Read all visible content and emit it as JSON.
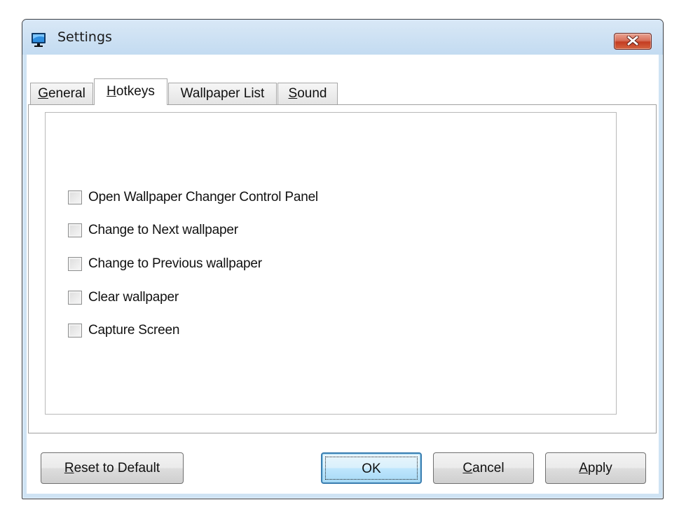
{
  "window": {
    "title": "Settings",
    "icon": "monitor-icon",
    "close_icon": "close-icon"
  },
  "tabs": [
    {
      "label": "General",
      "mnemonic": "G",
      "rest": "eneral",
      "active": false
    },
    {
      "label": "Hotkeys",
      "mnemonic": "H",
      "rest": "otkeys",
      "active": true
    },
    {
      "label": "Wallpaper List",
      "mnemonic": "",
      "rest": "Wallpaper List",
      "active": false
    },
    {
      "label": "Sound",
      "mnemonic": "S",
      "rest": "ound",
      "active": false
    }
  ],
  "hotkeys": {
    "options": [
      {
        "label": "Open Wallpaper Changer Control Panel",
        "checked": false
      },
      {
        "label": "Change to Next wallpaper",
        "checked": false
      },
      {
        "label": "Change to Previous wallpaper",
        "checked": false
      },
      {
        "label": "Clear wallpaper",
        "checked": false
      },
      {
        "label": "Capture Screen",
        "checked": false
      }
    ]
  },
  "buttons": {
    "reset": {
      "label": "Reset to Default",
      "mnemonic": "R",
      "rest": "eset to Default"
    },
    "ok": {
      "label": "OK"
    },
    "cancel": {
      "label": "Cancel",
      "mnemonic": "C",
      "rest": "ancel"
    },
    "apply": {
      "label": "Apply",
      "mnemonic": "A",
      "rest": "pply"
    }
  }
}
